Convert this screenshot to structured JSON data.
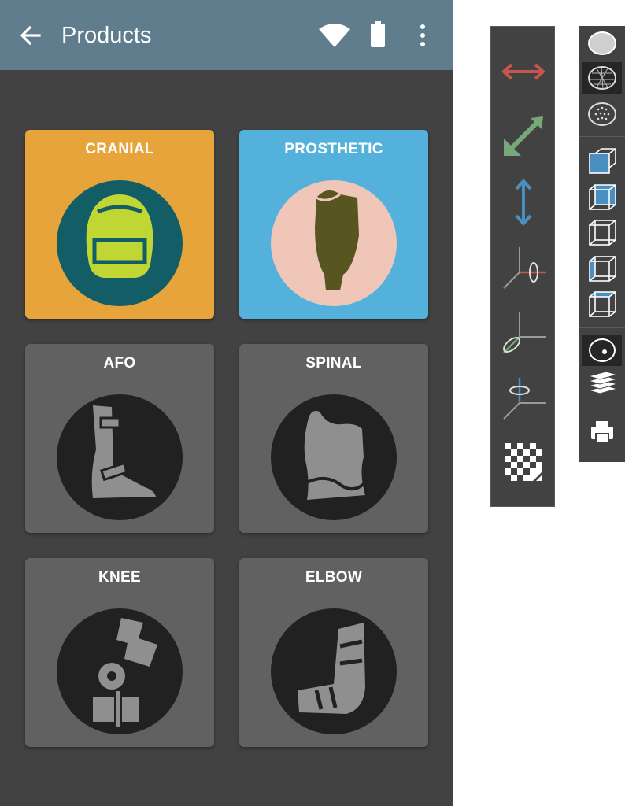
{
  "appbar": {
    "title": "Products",
    "back_icon": "arrow-left-icon",
    "status_icons": [
      "wifi-icon",
      "battery-icon"
    ],
    "menu_icon": "more-vert-icon"
  },
  "products": [
    {
      "label": "CRANIAL",
      "color": "#e6a43a",
      "circle": "#125d66",
      "icon": "cranial-helmet-icon"
    },
    {
      "label": "PROSTHETIC",
      "color": "#54b1dc",
      "circle": "#efc6b8",
      "icon": "prosthetic-leg-icon"
    },
    {
      "label": "AFO",
      "color": "#616161",
      "circle": "#212121",
      "icon": "afo-brace-icon"
    },
    {
      "label": "SPINAL",
      "color": "#616161",
      "circle": "#212121",
      "icon": "spinal-brace-icon"
    },
    {
      "label": "KNEE",
      "color": "#616161",
      "circle": "#212121",
      "icon": "knee-brace-icon"
    },
    {
      "label": "ELBOW",
      "color": "#616161",
      "circle": "#212121",
      "icon": "elbow-brace-icon"
    }
  ],
  "toolbar_transform": [
    "horizontal-arrow-icon",
    "diagonal-arrow-icon",
    "vertical-arrow-icon",
    "rotate-x-axis-icon",
    "rotate-z-axis-icon",
    "rotate-y-axis-icon",
    "checkerboard-icon"
  ],
  "toolbar_view": [
    "shaded-surface-icon",
    "wireframe-icon",
    "point-cloud-icon",
    "cube-front-view-icon",
    "cube-top-view-icon",
    "cube-side-view-icon",
    "cube-left-view-icon",
    "cube-right-view-icon",
    "cross-section-icon",
    "layers-icon",
    "print-icon"
  ],
  "colors": {
    "appbar": "#5f7d8c",
    "background": "#424242",
    "arrow_red": "#c8554b",
    "arrow_green": "#77a879",
    "arrow_blue": "#4a8fbf"
  }
}
